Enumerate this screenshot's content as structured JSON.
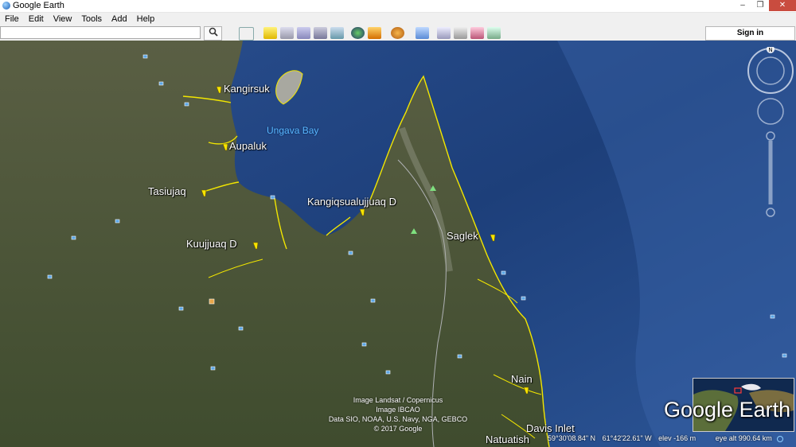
{
  "window": {
    "title": "Google Earth",
    "minimize": "–",
    "maximize": "❐",
    "close": "✕"
  },
  "menu": [
    "File",
    "Edit",
    "View",
    "Tools",
    "Add",
    "Help"
  ],
  "toolbar": {
    "search_value": "",
    "search_icon": "search-icon",
    "sign_in": "Sign in"
  },
  "places": {
    "kangirsuk": "Kangirsuk",
    "aupaluk": "Aupaluk",
    "tasiujaq": "Tasiujaq",
    "kangiqsualujjuaq": "Kangiqsualujjuaq D",
    "kuujjuaq": "Kuujjuaq D",
    "saglek": "Saglek",
    "nain": "Nain",
    "davis_inlet": "Davis Inlet",
    "natuatish": "Natuatish"
  },
  "water": {
    "ungava_bay": "Ungava Bay"
  },
  "credits": [
    "Image Landsat / Copernicus",
    "Image IBCAO",
    "Data SIO, NOAA, U.S. Navy, NGA, GEBCO",
    "© 2017 Google"
  ],
  "status": {
    "lat": "59°30'08.84\" N",
    "lon": "61°42'22.61\" W",
    "elev": "elev  -166 m",
    "eye": "eye alt 990.64 km"
  },
  "logo": "Google Earth",
  "compass": "N",
  "colors": {
    "ocean": "#1d3f7a",
    "land": "#4a5a3a",
    "coastline": "#f2e600",
    "pin": "#f7e400"
  }
}
